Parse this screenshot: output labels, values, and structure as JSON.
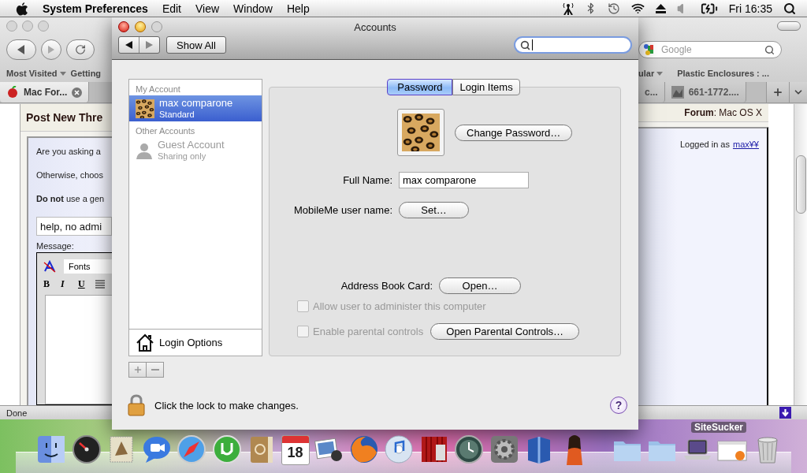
{
  "menu_bar": {
    "app": "System Preferences",
    "menus": [
      "Edit",
      "View",
      "Window",
      "Help"
    ],
    "clock": "Fri 16:35"
  },
  "browser": {
    "bookmarks_left": [
      {
        "label": "Most Visited",
        "menu": true
      },
      {
        "label": "Getting",
        "menu": false
      }
    ],
    "bookmarks_right": [
      {
        "label": "ular",
        "menu": true
      },
      {
        "label": "Plastic Enclosures : ...",
        "menu": false
      }
    ],
    "search_placeholder": "Google",
    "tabs_left": [
      {
        "label": "Mac For...",
        "selected": true
      }
    ],
    "tabs_right": [
      {
        "label": "c...",
        "selected": false
      },
      {
        "label": "661-1772....",
        "selected": false
      }
    ],
    "page": {
      "heading": "Post New Thre",
      "forum": "**Forum**: Mac OS X",
      "intro_lines": [
        "Are you asking a",
        "Otherwise, choos",
        "**Do not** use a gen"
      ],
      "title_value": "help, no admi",
      "message_label": "Message:",
      "font_menu": "Fonts",
      "format_buttons": [
        "B",
        "I",
        "U"
      ],
      "logged_in": "Logged in as",
      "user_link": "max¥¥"
    },
    "status": "Done"
  },
  "dialog": {
    "title": "Accounts",
    "show_all": "Show All",
    "account_groups": [
      {
        "heading": "My Account",
        "accounts": [
          {
            "name": "max comparone",
            "role": "Standard",
            "kind": "picture",
            "selected": true,
            "disabled": false
          }
        ]
      },
      {
        "heading": "Other Accounts",
        "accounts": [
          {
            "name": "Guest Account",
            "role": "Sharing only",
            "kind": "silhouette",
            "selected": false,
            "disabled": true
          }
        ]
      }
    ],
    "login_options": "Login Options",
    "tabs": [
      {
        "label": "Password",
        "selected": true
      },
      {
        "label": "Login Items",
        "selected": false
      }
    ],
    "change_password": "Change Password…",
    "full_name_label": "Full Name:",
    "full_name": "max comparone",
    "mobileme_label": "MobileMe user name:",
    "set_button": "Set…",
    "address_book_label": "Address Book Card:",
    "open_button": "Open…",
    "admin_checkbox": {
      "label": "Allow user to administer this computer",
      "checked": false,
      "disabled": true
    },
    "parental_checkbox": {
      "label": "Enable parental controls",
      "checked": false,
      "disabled": true
    },
    "parental_button": "Open Parental Controls…",
    "lock_text": "Click the lock to make changes.",
    "help": "?"
  },
  "dock": {
    "calendar_day": "18",
    "label": "SiteSucker"
  }
}
